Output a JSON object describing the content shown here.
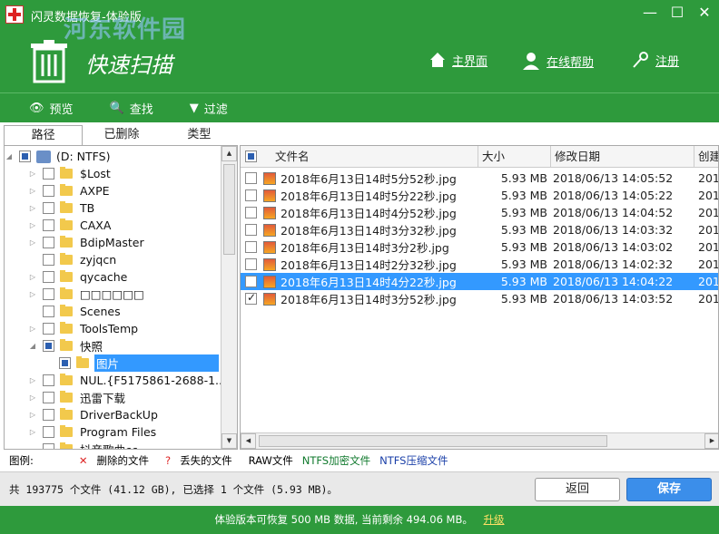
{
  "window": {
    "title": "闪灵数据恢复-体验版",
    "watermark": "河东软件园",
    "minimize": "—",
    "maximize": "☐",
    "close": "✕"
  },
  "header": {
    "scan_title": "快速扫描",
    "nav": {
      "home": "主界面",
      "help": "在线帮助",
      "register": "注册"
    }
  },
  "toolbar": {
    "preview": "预览",
    "search": "查找",
    "filter": "过滤"
  },
  "tabs": [
    "路径",
    "已删除",
    "类型"
  ],
  "tree": {
    "root": "(D: NTFS)",
    "items": [
      "$Lost",
      "AXPE",
      "TB",
      "CAXA",
      "BdipMaster",
      "zyjqcn",
      "qycache",
      "□□□□□□",
      "Scenes",
      "ToolsTemp",
      "快照",
      "图片",
      "NUL.{F5175861-2688-1...",
      "迅雷下载",
      "DriverBackUp",
      "Program Files",
      "抖音歌曲cc"
    ]
  },
  "table": {
    "headers": [
      "文件名",
      "大小",
      "修改日期",
      "创建"
    ],
    "rows": [
      {
        "name": "2018年6月13日14时5分52秒.jpg",
        "size": "5.93 MB",
        "date": "2018/06/13 14:05:52",
        "created": "201"
      },
      {
        "name": "2018年6月13日14时5分22秒.jpg",
        "size": "5.93 MB",
        "date": "2018/06/13 14:05:22",
        "created": "201"
      },
      {
        "name": "2018年6月13日14时4分52秒.jpg",
        "size": "5.93 MB",
        "date": "2018/06/13 14:04:52",
        "created": "201"
      },
      {
        "name": "2018年6月13日14时3分32秒.jpg",
        "size": "5.93 MB",
        "date": "2018/06/13 14:03:32",
        "created": "201"
      },
      {
        "name": "2018年6月13日14时3分2秒.jpg",
        "size": "5.93 MB",
        "date": "2018/06/13 14:03:02",
        "created": "201"
      },
      {
        "name": "2018年6月13日14时2分32秒.jpg",
        "size": "5.93 MB",
        "date": "2018/06/13 14:02:32",
        "created": "201"
      },
      {
        "name": "2018年6月13日14时4分22秒.jpg",
        "size": "5.93 MB",
        "date": "2018/06/13 14:04:22",
        "created": "201"
      },
      {
        "name": "2018年6月13日14时3分52秒.jpg",
        "size": "5.93 MB",
        "date": "2018/06/13 14:03:52",
        "created": "201"
      }
    ]
  },
  "legend": {
    "label": "图例:",
    "deleted": "删除的文件",
    "lost": "丢失的文件",
    "raw": "RAW文件",
    "ntfs_enc": "NTFS加密文件",
    "ntfs_comp": "NTFS压缩文件"
  },
  "status": {
    "text": "共 193775 个文件 (41.12 GB), 已选择 1 个文件 (5.93 MB)。",
    "back": "返回",
    "save": "保存"
  },
  "footer": {
    "text": "体验版本可恢复 500 MB 数据, 当前剩余 494.06 MB。",
    "upgrade": "升级"
  },
  "colors": {
    "brand_green": "#2e9a3c",
    "selection_blue": "#3399ff",
    "save_blue": "#3b8eea"
  }
}
